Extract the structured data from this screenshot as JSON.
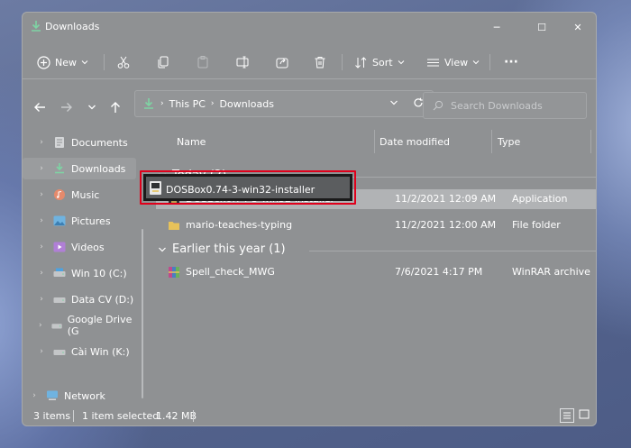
{
  "window": {
    "title": "Downloads",
    "controls": {
      "minimize": "─",
      "maximize": "☐",
      "close": "✕"
    }
  },
  "commandbar": {
    "new_label": "New",
    "sort_label": "Sort",
    "view_label": "View",
    "more_label": "···"
  },
  "address": {
    "path": [
      "This PC",
      "Downloads"
    ],
    "search_placeholder": "Search Downloads"
  },
  "sidebar": {
    "items": [
      {
        "label": "Documents",
        "icon": "documents-icon"
      },
      {
        "label": "Downloads",
        "icon": "downloads-icon"
      },
      {
        "label": "Music",
        "icon": "music-icon"
      },
      {
        "label": "Pictures",
        "icon": "pictures-icon"
      },
      {
        "label": "Videos",
        "icon": "videos-icon"
      },
      {
        "label": "Win 10 (C:)",
        "icon": "drive-icon"
      },
      {
        "label": "Data CV (D:)",
        "icon": "drive-icon"
      },
      {
        "label": "Google Drive (G",
        "icon": "drive-icon"
      },
      {
        "label": "Cài Win (K:)",
        "icon": "drive-icon"
      },
      {
        "label": "Network",
        "icon": "network-icon"
      }
    ],
    "active_index": 1
  },
  "columns": {
    "name": "Name",
    "date": "Date modified",
    "type": "Type"
  },
  "groups": [
    {
      "label": "Today (2)",
      "files": [
        {
          "name": "DOSBox0.74-3-win32-installer",
          "date": "11/2/2021 12:09 AM",
          "type": "Application",
          "selected": true
        },
        {
          "name": "mario-teaches-typing",
          "date": "11/2/2021 12:00 AM",
          "type": "File folder",
          "selected": false
        }
      ]
    },
    {
      "label": "Earlier this year (1)",
      "files": [
        {
          "name": "Spell_check_MWG",
          "date": "7/6/2021 4:17 PM",
          "type": "WinRAR archive",
          "selected": false
        }
      ]
    }
  ],
  "status": {
    "items_count": "3 items",
    "selected": "1 item selected",
    "size": "1.42 MB"
  },
  "colors": {
    "accent_green": "#7ed4a4",
    "highlight_red": "#e0001b",
    "folder_yellow": "#e7c25a"
  }
}
